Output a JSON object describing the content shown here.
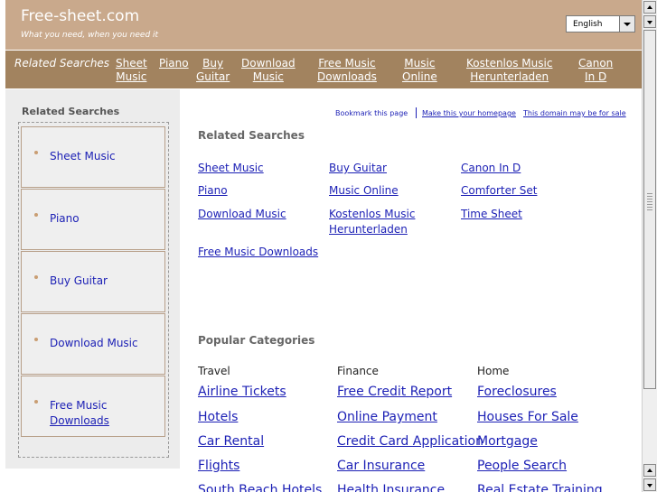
{
  "header": {
    "title": "Free-sheet.com",
    "tagline": "What you need, when you need it",
    "language": "English"
  },
  "topnav": {
    "lead": "Related Searches",
    "items": [
      {
        "l1": "Sheet",
        "l2": "Music"
      },
      {
        "l1": "Piano",
        "l2": ""
      },
      {
        "l1": "Buy",
        "l2": "Guitar"
      },
      {
        "l1": "Download",
        "l2": "Music"
      },
      {
        "l1": "Free Music",
        "l2": "Downloads"
      },
      {
        "l1": "Music",
        "l2": "Online"
      },
      {
        "l1": "Kostenlos Music",
        "l2": "Herunterladen"
      },
      {
        "l1": "Canon",
        "l2": "In D"
      }
    ]
  },
  "sidebar": {
    "title": "Related Searches",
    "items": [
      {
        "l1": "Sheet Music",
        "l2": ""
      },
      {
        "l1": "Piano",
        "l2": ""
      },
      {
        "l1": "Buy Guitar",
        "l2": ""
      },
      {
        "l1": "Download Music",
        "l2": ""
      },
      {
        "l1": "Free Music",
        "l2": "Downloads"
      }
    ]
  },
  "bookmark_bar": {
    "bookmark": "Bookmark this page",
    "homepage": "Make this your homepage",
    "for_sale": "This domain may be for sale"
  },
  "related": {
    "title": "Related Searches",
    "links": [
      {
        "l1": "Sheet Music",
        "l2": ""
      },
      {
        "l1": "Buy Guitar",
        "l2": ""
      },
      {
        "l1": "Canon In D",
        "l2": ""
      },
      {
        "l1": "Piano",
        "l2": ""
      },
      {
        "l1": "Music Online",
        "l2": ""
      },
      {
        "l1": "Comforter Set",
        "l2": ""
      },
      {
        "l1": "Download Music",
        "l2": ""
      },
      {
        "l1": "Kostenlos Music",
        "l2": "Herunterladen"
      },
      {
        "l1": "Time Sheet",
        "l2": ""
      },
      {
        "l1": "Free Music Downloads",
        "l2": ""
      }
    ]
  },
  "popular": {
    "title": "Popular Categories",
    "columns": [
      {
        "head": "Travel",
        "links": [
          "Airline Tickets",
          "Hotels",
          "Car Rental",
          "Flights",
          "South Beach Hotels"
        ]
      },
      {
        "head": "Finance",
        "links": [
          "Free Credit Report",
          "Online Payment",
          "Credit Card Application",
          "Car Insurance",
          "Health Insurance"
        ]
      },
      {
        "head": "Home",
        "links": [
          "Foreclosures",
          "Houses For Sale",
          "Mortgage",
          "People Search",
          "Real Estate Training"
        ]
      }
    ]
  }
}
